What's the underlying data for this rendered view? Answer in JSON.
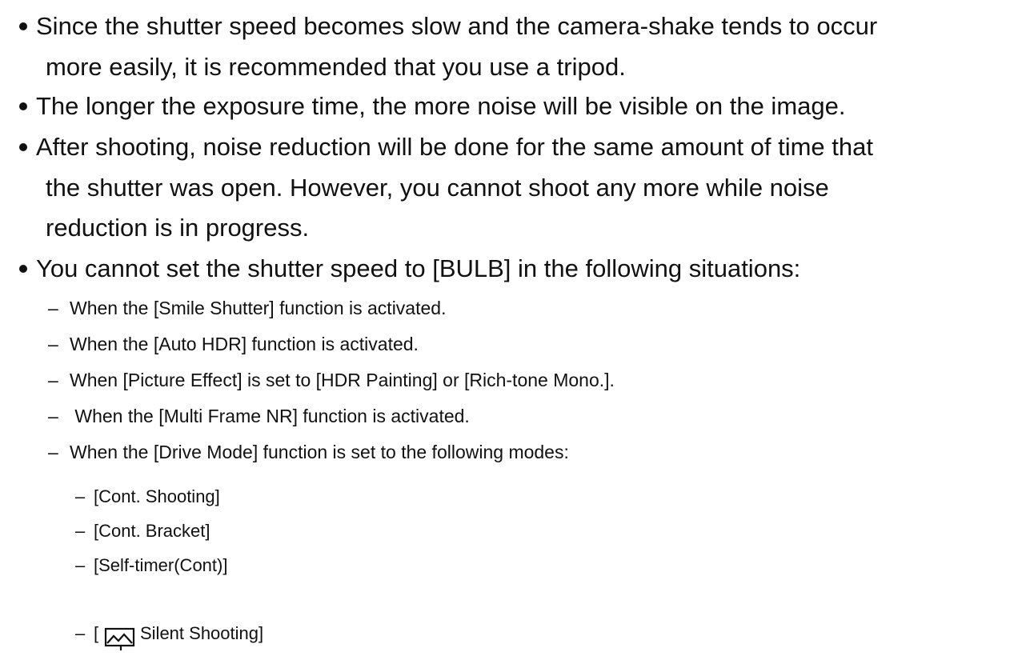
{
  "notes": {
    "items": [
      {
        "lines": [
          "Since the shutter speed becomes slow and the camera-shake tends to occur",
          "more easily, it is recommended that you use a tripod."
        ]
      },
      {
        "lines": [
          "The longer the exposure time, the more noise will be visible on the image."
        ]
      },
      {
        "lines": [
          "After shooting, noise reduction will be done for the same amount of time that",
          "the shutter was open. However, you cannot shoot any more while noise",
          "reduction is in progress."
        ]
      },
      {
        "lines": [
          "You cannot set the shutter speed to [BULB] in the following situations:"
        ]
      }
    ],
    "sub_dash": "–",
    "situations": [
      "When the [Smile Shutter] function is activated.",
      "When the [Auto HDR] function is activated.",
      "When [Picture Effect] is set to [HDR Painting] or [Rich-tone Mono.].",
      " When the [Multi Frame NR] function is activated.",
      "When the [Drive Mode] function is set to the following modes:"
    ],
    "mode_dash": "–",
    "modes": [
      "[Cont. Shooting]",
      "[Cont. Bracket]",
      "[Self-timer(Cont)]"
    ],
    "silent_mode": {
      "open_bracket": "[",
      "icon": "silent-shooting-icon",
      "label": "Silent Shooting]"
    }
  }
}
